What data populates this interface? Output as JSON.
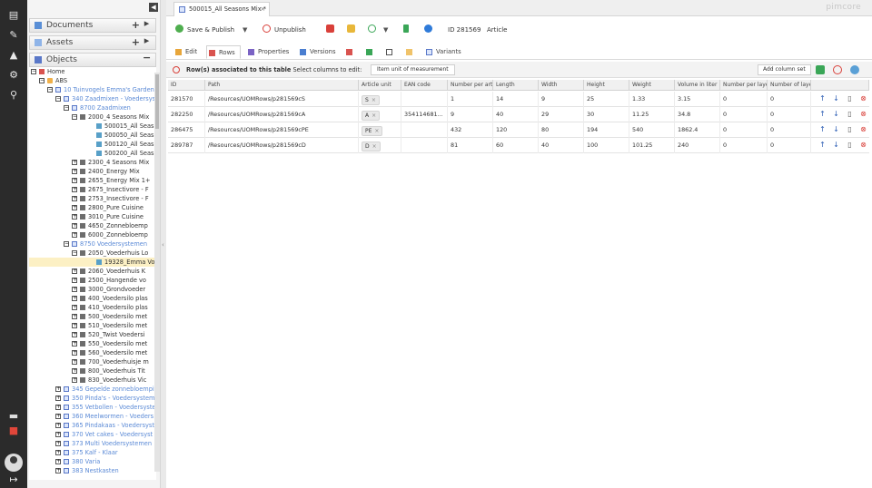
{
  "tree": {
    "accordion": [
      {
        "label": "Documents"
      },
      {
        "label": "Assets"
      },
      {
        "label": "Objects"
      }
    ],
    "items": [
      {
        "label": "Home",
        "indent": 0,
        "icon": "home",
        "toggle": "-"
      },
      {
        "label": "ABS",
        "indent": 1,
        "icon": "folder",
        "toggle": "-"
      },
      {
        "label": "10 Tuinvogels Emma's Garden",
        "indent": 2,
        "icon": "var",
        "toggle": "-",
        "blue": true
      },
      {
        "label": "340 Zaadmixen - Voedersys",
        "indent": 3,
        "icon": "var",
        "toggle": "-",
        "blue": true
      },
      {
        "label": "8700 Zaadmixen",
        "indent": 4,
        "icon": "var",
        "toggle": "-",
        "blue": true
      },
      {
        "label": "2000_4 Seasons Mix",
        "indent": 5,
        "icon": "obj",
        "toggle": "-"
      },
      {
        "label": "500015_All Seas",
        "indent": 7,
        "icon": "leaf"
      },
      {
        "label": "500050_All Seas",
        "indent": 7,
        "icon": "leaf"
      },
      {
        "label": "500120_All Seas",
        "indent": 7,
        "icon": "leaf"
      },
      {
        "label": "500200_All Seas",
        "indent": 7,
        "icon": "leaf"
      },
      {
        "label": "2300_4 Seasons Mix",
        "indent": 5,
        "icon": "obj",
        "toggle": "+"
      },
      {
        "label": "2400_Energy Mix",
        "indent": 5,
        "icon": "obj",
        "toggle": "+"
      },
      {
        "label": "2655_Energy Mix 1+",
        "indent": 5,
        "icon": "obj",
        "toggle": "+"
      },
      {
        "label": "2675_Insectivore - F",
        "indent": 5,
        "icon": "obj",
        "toggle": "+"
      },
      {
        "label": "2753_Insectivore - F",
        "indent": 5,
        "icon": "obj",
        "toggle": "+"
      },
      {
        "label": "2800_Pure Cuisine",
        "indent": 5,
        "icon": "obj",
        "toggle": "+"
      },
      {
        "label": "3010_Pure Cuisine",
        "indent": 5,
        "icon": "obj",
        "toggle": "+"
      },
      {
        "label": "4650_Zonnebloemp",
        "indent": 5,
        "icon": "obj",
        "toggle": "+"
      },
      {
        "label": "6000_Zonnebloemp",
        "indent": 5,
        "icon": "obj",
        "toggle": "+"
      },
      {
        "label": "8750 Voedersystemen",
        "indent": 4,
        "icon": "var",
        "toggle": "-",
        "blue": true
      },
      {
        "label": "2050_Voederhuis Lo",
        "indent": 5,
        "icon": "obj",
        "toggle": "-"
      },
      {
        "label": "19328_Emma Vo",
        "indent": 7,
        "icon": "leaf",
        "selected": true
      },
      {
        "label": "2060_Voederhuis K",
        "indent": 5,
        "icon": "obj",
        "toggle": "+"
      },
      {
        "label": "2500_Hangende vo",
        "indent": 5,
        "icon": "obj",
        "toggle": "+"
      },
      {
        "label": "3000_Grondvoeder",
        "indent": 5,
        "icon": "obj",
        "toggle": "+"
      },
      {
        "label": "400_Voedersilo plas",
        "indent": 5,
        "icon": "obj",
        "toggle": "+"
      },
      {
        "label": "410_Voedersilo plas",
        "indent": 5,
        "icon": "obj",
        "toggle": "+"
      },
      {
        "label": "500_Voedersilo met",
        "indent": 5,
        "icon": "obj",
        "toggle": "+"
      },
      {
        "label": "510_Voedersilo met",
        "indent": 5,
        "icon": "obj",
        "toggle": "+"
      },
      {
        "label": "520_Twist Voedersi",
        "indent": 5,
        "icon": "obj",
        "toggle": "+"
      },
      {
        "label": "550_Voedersilo met",
        "indent": 5,
        "icon": "obj",
        "toggle": "+"
      },
      {
        "label": "560_Voedersilo met",
        "indent": 5,
        "icon": "obj",
        "toggle": "+"
      },
      {
        "label": "700_Voederhuisje m",
        "indent": 5,
        "icon": "obj",
        "toggle": "+"
      },
      {
        "label": "800_Voederhuis Tit",
        "indent": 5,
        "icon": "obj",
        "toggle": "+"
      },
      {
        "label": "830_Voederhuis Vic",
        "indent": 5,
        "icon": "obj",
        "toggle": "+"
      },
      {
        "label": "345 Gepelde zonnebloempitt",
        "indent": 3,
        "icon": "var",
        "toggle": "+",
        "blue": true
      },
      {
        "label": "350 Pinda's - Voedersystem",
        "indent": 3,
        "icon": "var",
        "toggle": "+",
        "blue": true
      },
      {
        "label": "355 Vetbollen - Voedersyste",
        "indent": 3,
        "icon": "var",
        "toggle": "+",
        "blue": true
      },
      {
        "label": "360 Meelwormen - Voeders",
        "indent": 3,
        "icon": "var",
        "toggle": "+",
        "blue": true
      },
      {
        "label": "365 Pindakaas - Voedersyst",
        "indent": 3,
        "icon": "var",
        "toggle": "+",
        "blue": true
      },
      {
        "label": "370 Vet cakes - Voedersyst",
        "indent": 3,
        "icon": "var",
        "toggle": "+",
        "blue": true
      },
      {
        "label": "373 Multi Voedersystemen",
        "indent": 3,
        "icon": "var",
        "toggle": "+",
        "blue": true
      },
      {
        "label": "375 Kalf - Klaar",
        "indent": 3,
        "icon": "var",
        "toggle": "+",
        "blue": true
      },
      {
        "label": "380 Varia",
        "indent": 3,
        "icon": "var",
        "toggle": "+",
        "blue": true
      },
      {
        "label": "383 Nestkasten",
        "indent": 3,
        "icon": "var",
        "toggle": "+",
        "blue": true
      }
    ]
  },
  "tab": {
    "label": "500015_All Seasons Mix *"
  },
  "brand": "pimcore",
  "toolbar": {
    "save_publish": "Save & Publish",
    "unpublish": "Unpublish",
    "id_label": "ID 281569",
    "type_label": "Article"
  },
  "subtabs": [
    {
      "label": "Edit"
    },
    {
      "label": "Rows"
    },
    {
      "label": "Properties"
    },
    {
      "label": "Versions"
    },
    {
      "label": ""
    },
    {
      "label": ""
    },
    {
      "label": ""
    },
    {
      "label": ""
    },
    {
      "label": "Variants"
    }
  ],
  "infobar": {
    "title": "Row(s) associated to this table",
    "hint": "Select columns to edit:",
    "selected": "Item unit of measurement",
    "add_set": "Add column set"
  },
  "grid": {
    "columns": [
      "ID",
      "Path",
      "Article unit",
      "EAN code",
      "Number per artic",
      "Length",
      "Width",
      "Height",
      "Weight",
      "Volume in liter",
      "Number per laye",
      "Number of layer"
    ],
    "rows": [
      {
        "id": "281570",
        "path": "/Resources/UOMRows/p281569cS",
        "unit": "S",
        "ean": "",
        "number": "1",
        "length": "14",
        "width": "9",
        "height": "25",
        "weight": "1.33",
        "volume": "3.15",
        "per_layer": "0",
        "layers": "0"
      },
      {
        "id": "282250",
        "path": "/Resources/UOMRows/p281569cA",
        "unit": "A",
        "ean": "354114681...",
        "number": "9",
        "length": "40",
        "width": "29",
        "height": "30",
        "weight": "11.25",
        "volume": "34.8",
        "per_layer": "0",
        "layers": "0"
      },
      {
        "id": "286475",
        "path": "/Resources/UOMRows/p281569cPE",
        "unit": "PE",
        "ean": "",
        "number": "432",
        "length": "120",
        "width": "80",
        "height": "194",
        "weight": "540",
        "volume": "1862.4",
        "per_layer": "0",
        "layers": "0"
      },
      {
        "id": "289787",
        "path": "/Resources/UOMRows/p281569cD",
        "unit": "D",
        "ean": "",
        "number": "81",
        "length": "60",
        "width": "40",
        "height": "100",
        "weight": "101.25",
        "volume": "240",
        "per_layer": "0",
        "layers": "0"
      }
    ]
  }
}
